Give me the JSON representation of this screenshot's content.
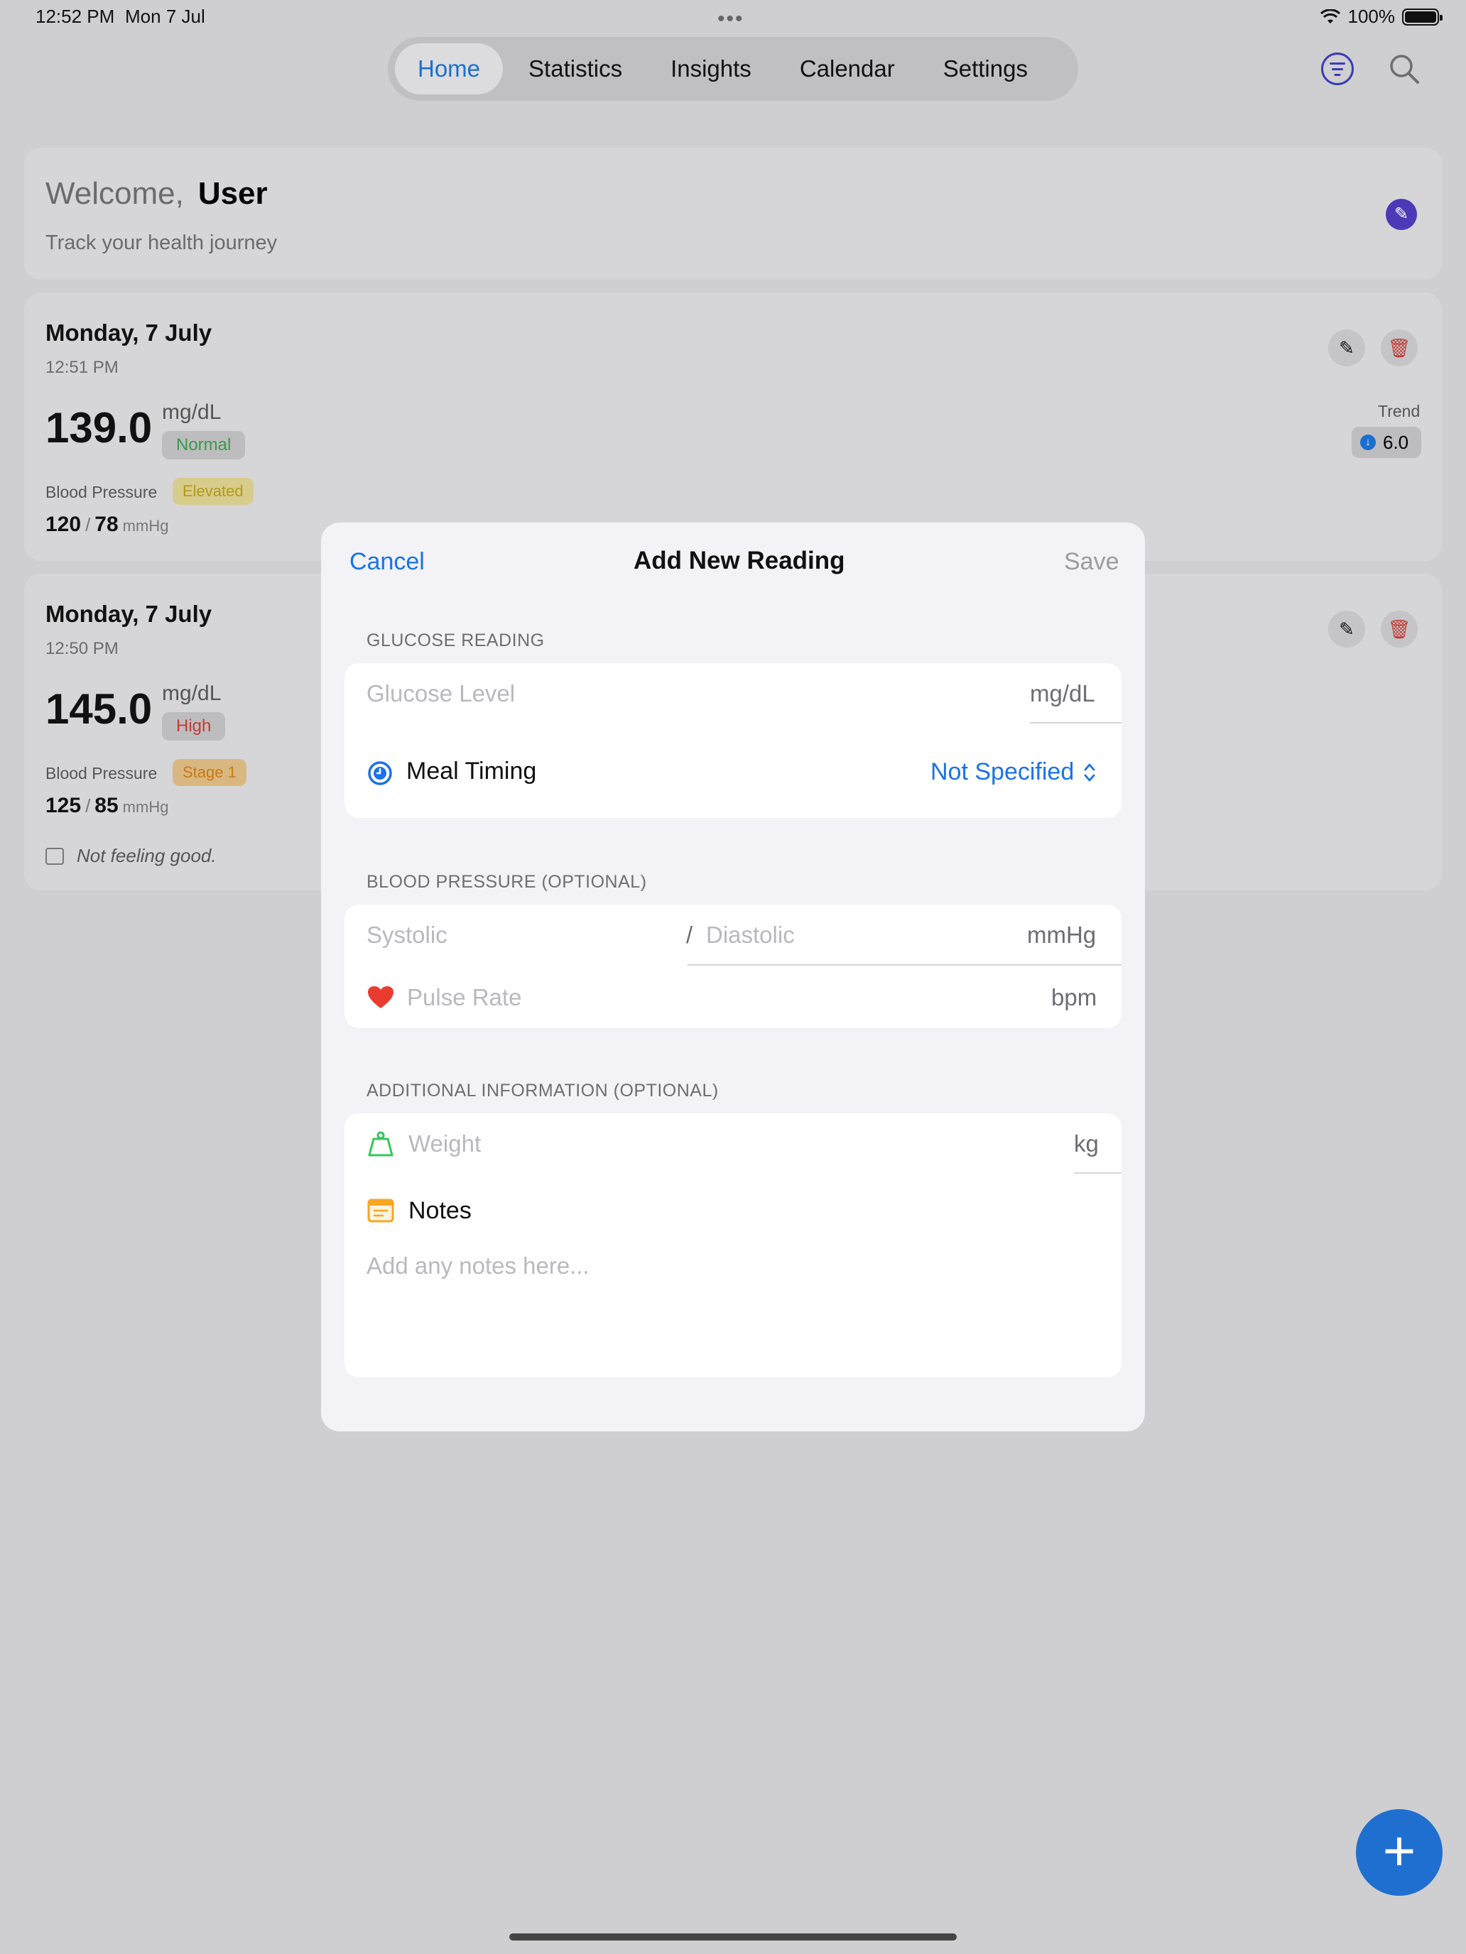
{
  "status_bar": {
    "time": "12:52 PM",
    "date": "Mon 7 Jul",
    "battery": "100%"
  },
  "tabs": [
    {
      "label": "Home",
      "active": true
    },
    {
      "label": "Statistics"
    },
    {
      "label": "Insights"
    },
    {
      "label": "Calendar"
    },
    {
      "label": "Settings"
    }
  ],
  "welcome": {
    "greeting": "Welcome,",
    "name": "User",
    "subtitle": "Track your health journey"
  },
  "readings": [
    {
      "date": "Monday, 7 July",
      "time": "12:51 PM",
      "value": "139.0",
      "unit": "mg/dL",
      "status": "Normal",
      "bp_label": "Blood Pressure",
      "bp_status": "Elevated",
      "systolic": "120",
      "diastolic": "78",
      "bp_unit": "mmHg",
      "trend_label": "Trend",
      "trend_value": "6.0"
    },
    {
      "date": "Monday, 7 July",
      "time": "12:50 PM",
      "value": "145.0",
      "unit": "mg/dL",
      "status": "High",
      "bp_label": "Blood Pressure",
      "bp_status": "Stage 1",
      "systolic": "125",
      "diastolic": "85",
      "bp_unit": "mmHg",
      "note": "Not feeling good."
    }
  ],
  "modal": {
    "cancel": "Cancel",
    "title": "Add New Reading",
    "save": "Save",
    "glucose_section": "GLUCOSE READING",
    "glucose_placeholder": "Glucose Level",
    "glucose_unit": "mg/dL",
    "meal_timing_label": "Meal Timing",
    "meal_timing_value": "Not Specified",
    "bp_section": "BLOOD PRESSURE (OPTIONAL)",
    "systolic_placeholder": "Systolic",
    "bp_separator": "/",
    "diastolic_placeholder": "Diastolic",
    "bp_unit": "mmHg",
    "pulse_placeholder": "Pulse Rate",
    "pulse_unit": "bpm",
    "additional_section": "ADDITIONAL INFORMATION (OPTIONAL)",
    "weight_placeholder": "Weight",
    "weight_unit": "kg",
    "notes_label": "Notes",
    "notes_placeholder": "Add any notes here..."
  },
  "colors": {
    "accent": "#1a73e8",
    "purple": "#4a3ab6",
    "danger": "#c23b35"
  }
}
